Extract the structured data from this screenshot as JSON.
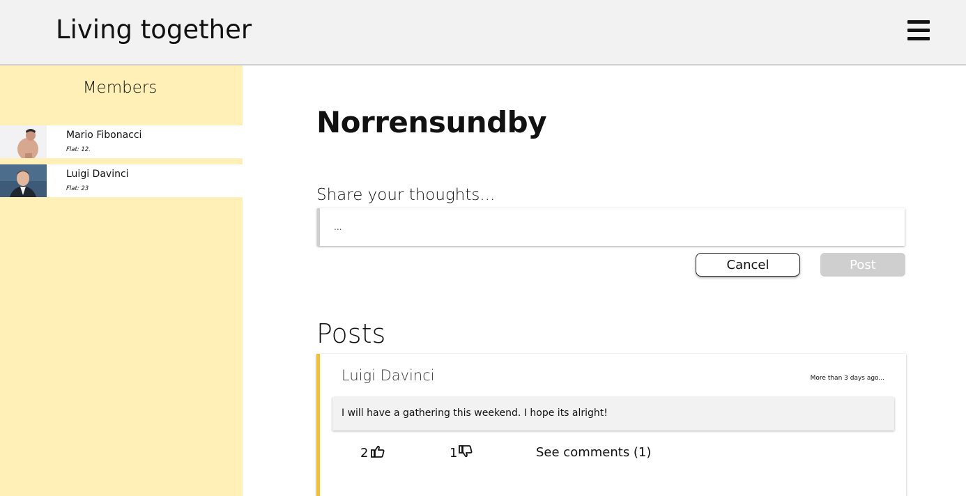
{
  "header": {
    "title": "Living together",
    "menu_icon": "hamburger-menu-icon"
  },
  "sidebar": {
    "title": "Members",
    "members": [
      {
        "name": "Mario Fibonacci",
        "flat": "Flat: 12."
      },
      {
        "name": "Luigi Davinci",
        "flat": "Flat: 23"
      }
    ]
  },
  "main": {
    "title": "Norrensundby",
    "share_label": "Share your thoughts...",
    "input_placeholder": "...",
    "cancel_label": "Cancel",
    "post_label": "Post",
    "posts_heading": "Posts"
  },
  "posts": [
    {
      "author": "Luigi Davinci",
      "time": "More than 3 days ago...",
      "body": "I will have a gathering this weekend. I hope its alright!",
      "likes": "2",
      "dislikes": "1",
      "comments_label": "See comments (1)"
    }
  ],
  "colors": {
    "header_bg": "#f2f2f2",
    "sidebar_bg": "#fff0b7",
    "post_accent": "#f0c233",
    "post_button_disabled": "#cfcfcf"
  }
}
